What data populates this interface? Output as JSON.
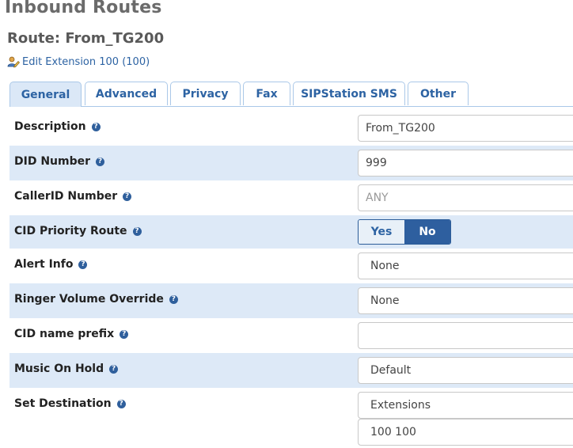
{
  "page": {
    "title": "Inbound Routes"
  },
  "route": {
    "title": "Route: From_TG200",
    "edit_link": "Edit Extension 100 (100)"
  },
  "tabs": [
    {
      "label": "General",
      "active": true
    },
    {
      "label": "Advanced",
      "active": false
    },
    {
      "label": "Privacy",
      "active": false
    },
    {
      "label": "Fax",
      "active": false
    },
    {
      "label": "SIPStation SMS",
      "active": false
    },
    {
      "label": "Other",
      "active": false
    }
  ],
  "form": {
    "description": {
      "label": "Description",
      "value": "From_TG200"
    },
    "did_number": {
      "label": "DID Number",
      "value": "999"
    },
    "callerid_number": {
      "label": "CallerID Number",
      "placeholder": "ANY"
    },
    "cid_priority_route": {
      "label": "CID Priority Route",
      "options": [
        "Yes",
        "No"
      ],
      "selected": "No"
    },
    "alert_info": {
      "label": "Alert Info",
      "value": "None"
    },
    "ringer_volume_override": {
      "label": "Ringer Volume Override",
      "value": "None"
    },
    "cid_name_prefix": {
      "label": "CID name prefix",
      "value": ""
    },
    "music_on_hold": {
      "label": "Music On Hold",
      "value": "Default"
    },
    "set_destination": {
      "label": "Set Destination",
      "type_value": "Extensions",
      "target_value": "100 100"
    }
  },
  "help_icon_glyph": "?",
  "colors": {
    "accent": "#2e5f9f",
    "link": "#2d63a3",
    "row_shade": "#dde9f7",
    "active_tab": "#dbe8f7"
  },
  "icons": {
    "edit": "user-edit-icon",
    "help": "question-circle-icon"
  }
}
